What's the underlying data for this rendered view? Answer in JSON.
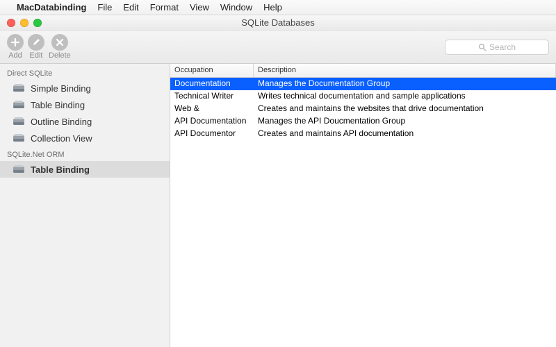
{
  "menubar": {
    "appname": "MacDatabinding",
    "items": [
      "File",
      "Edit",
      "Format",
      "View",
      "Window",
      "Help"
    ]
  },
  "window": {
    "title": "SQLite Databases"
  },
  "toolbar": {
    "add": "Add",
    "edit": "Edit",
    "delete": "Delete",
    "search_placeholder": "Search"
  },
  "sidebar": {
    "groups": [
      {
        "title": "Direct SQLite",
        "items": [
          {
            "label": "Simple Binding",
            "selected": false
          },
          {
            "label": "Table Binding",
            "selected": false
          },
          {
            "label": "Outline Binding",
            "selected": false
          },
          {
            "label": "Collection View",
            "selected": false
          }
        ]
      },
      {
        "title": "SQLite.Net ORM",
        "items": [
          {
            "label": "Table Binding",
            "selected": true
          }
        ]
      }
    ]
  },
  "table": {
    "columns": {
      "occupation": "Occupation",
      "description": "Description"
    },
    "rows": [
      {
        "occupation": "Documentation",
        "description": "Manages the Documentation Group",
        "selected": true
      },
      {
        "occupation": "Technical Writer",
        "description": "Writes technical documentation and sample applications",
        "selected": false
      },
      {
        "occupation": "Web &",
        "description": "Creates and maintains the websites that drive documentation",
        "selected": false
      },
      {
        "occupation": "API Documentation",
        "description": "Manages the API Doucmentation Group",
        "selected": false
      },
      {
        "occupation": "API Documentor",
        "description": "Creates and maintains API documentation",
        "selected": false
      }
    ]
  }
}
